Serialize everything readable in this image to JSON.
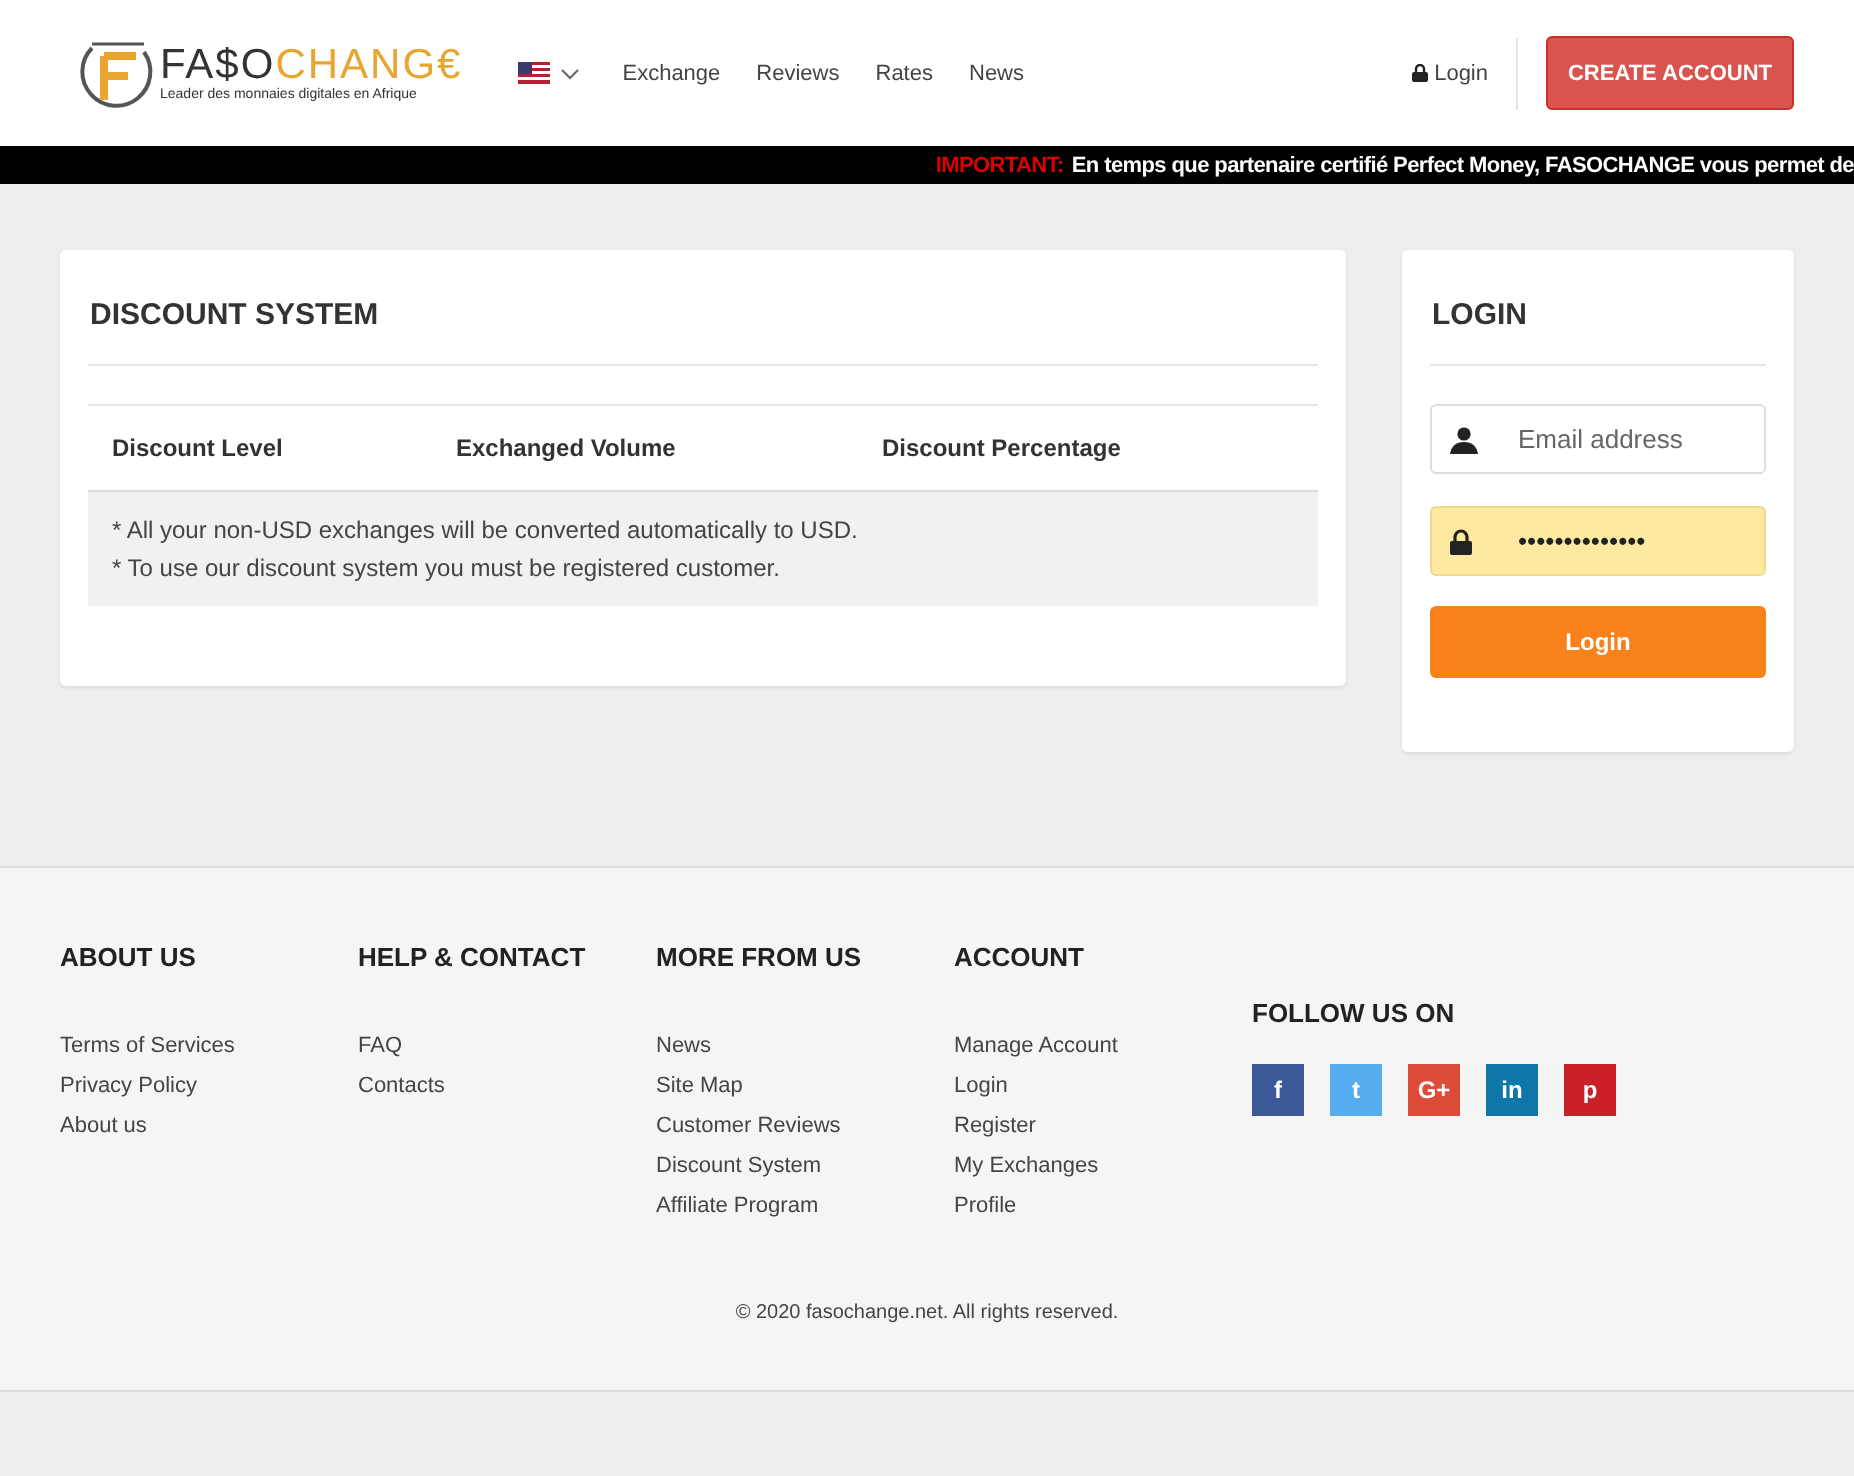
{
  "header": {
    "logo": {
      "part_1": "FA$O",
      "part_2": "CHANG€",
      "tagline": "Leader des monnaies digitales en Afrique"
    },
    "nav": [
      {
        "label": "Exchange"
      },
      {
        "label": "Reviews"
      },
      {
        "label": "Rates"
      },
      {
        "label": "News"
      }
    ],
    "login_link": "Login",
    "create_account": "CREATE ACCOUNT"
  },
  "ticker": {
    "label": "IMPORTANT:",
    "text": "En temps que partenaire certifié Perfect Money, FASOCHANGE vous permet de"
  },
  "discount": {
    "title": "DISCOUNT SYSTEM",
    "columns": [
      "Discount Level",
      "Exchanged Volume",
      "Discount Percentage"
    ],
    "notes": [
      "* All your non-USD exchanges will be converted automatically to USD.",
      "* To use our discount system you must be registered customer."
    ]
  },
  "login": {
    "title": "LOGIN",
    "email": {
      "placeholder": "Email address"
    },
    "password": {
      "value": "••••••••••••••"
    },
    "button": "Login"
  },
  "footer": {
    "columns": [
      {
        "title": "ABOUT US",
        "links": [
          "Terms of Services",
          "Privacy Policy",
          "About us"
        ]
      },
      {
        "title": "HELP & CONTACT",
        "links": [
          "FAQ",
          "Contacts"
        ]
      },
      {
        "title": "MORE FROM US",
        "links": [
          "News",
          "Site Map",
          "Customer Reviews",
          "Discount System",
          "Affiliate Program"
        ]
      },
      {
        "title": "ACCOUNT",
        "links": [
          "Manage Account",
          "Login",
          "Register",
          "My Exchanges",
          "Profile"
        ]
      }
    ],
    "follow": {
      "title": "FOLLOW US ON",
      "social": [
        {
          "glyph": "f",
          "color": "#3b5998"
        },
        {
          "glyph": "t",
          "color": "#55acee"
        },
        {
          "glyph": "G+",
          "color": "#dd4b39"
        },
        {
          "glyph": "in",
          "color": "#0e76a8"
        },
        {
          "glyph": "p",
          "color": "#cb2027"
        }
      ]
    },
    "copyright": "© 2020 fasochange.net. All rights reserved."
  }
}
